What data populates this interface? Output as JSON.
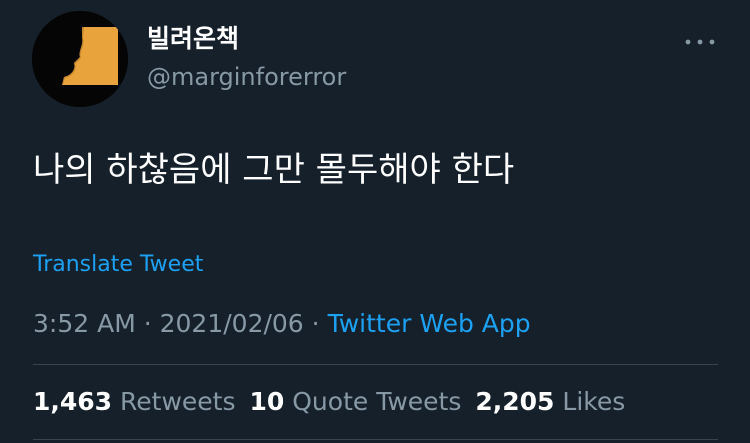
{
  "user": {
    "display_name": "빌려온책",
    "handle": "@marginforerror",
    "avatar_icon": "profile-silhouette-icon"
  },
  "tweet": {
    "text": "나의 하찮음에 그만 몰두해야 한다",
    "translate_label": "Translate Tweet"
  },
  "meta": {
    "time": "3:52 AM",
    "date": "2021/02/06",
    "separator": "·",
    "source": "Twitter Web App"
  },
  "stats": {
    "retweets": {
      "count": "1,463",
      "label": "Retweets"
    },
    "quote_tweets": {
      "count": "10",
      "label": "Quote Tweets"
    },
    "likes": {
      "count": "2,205",
      "label": "Likes"
    }
  },
  "colors": {
    "background": "#15202b",
    "accent": "#1da1f2",
    "secondary_text": "#8899a6",
    "avatar_fill": "#e8a33c"
  }
}
